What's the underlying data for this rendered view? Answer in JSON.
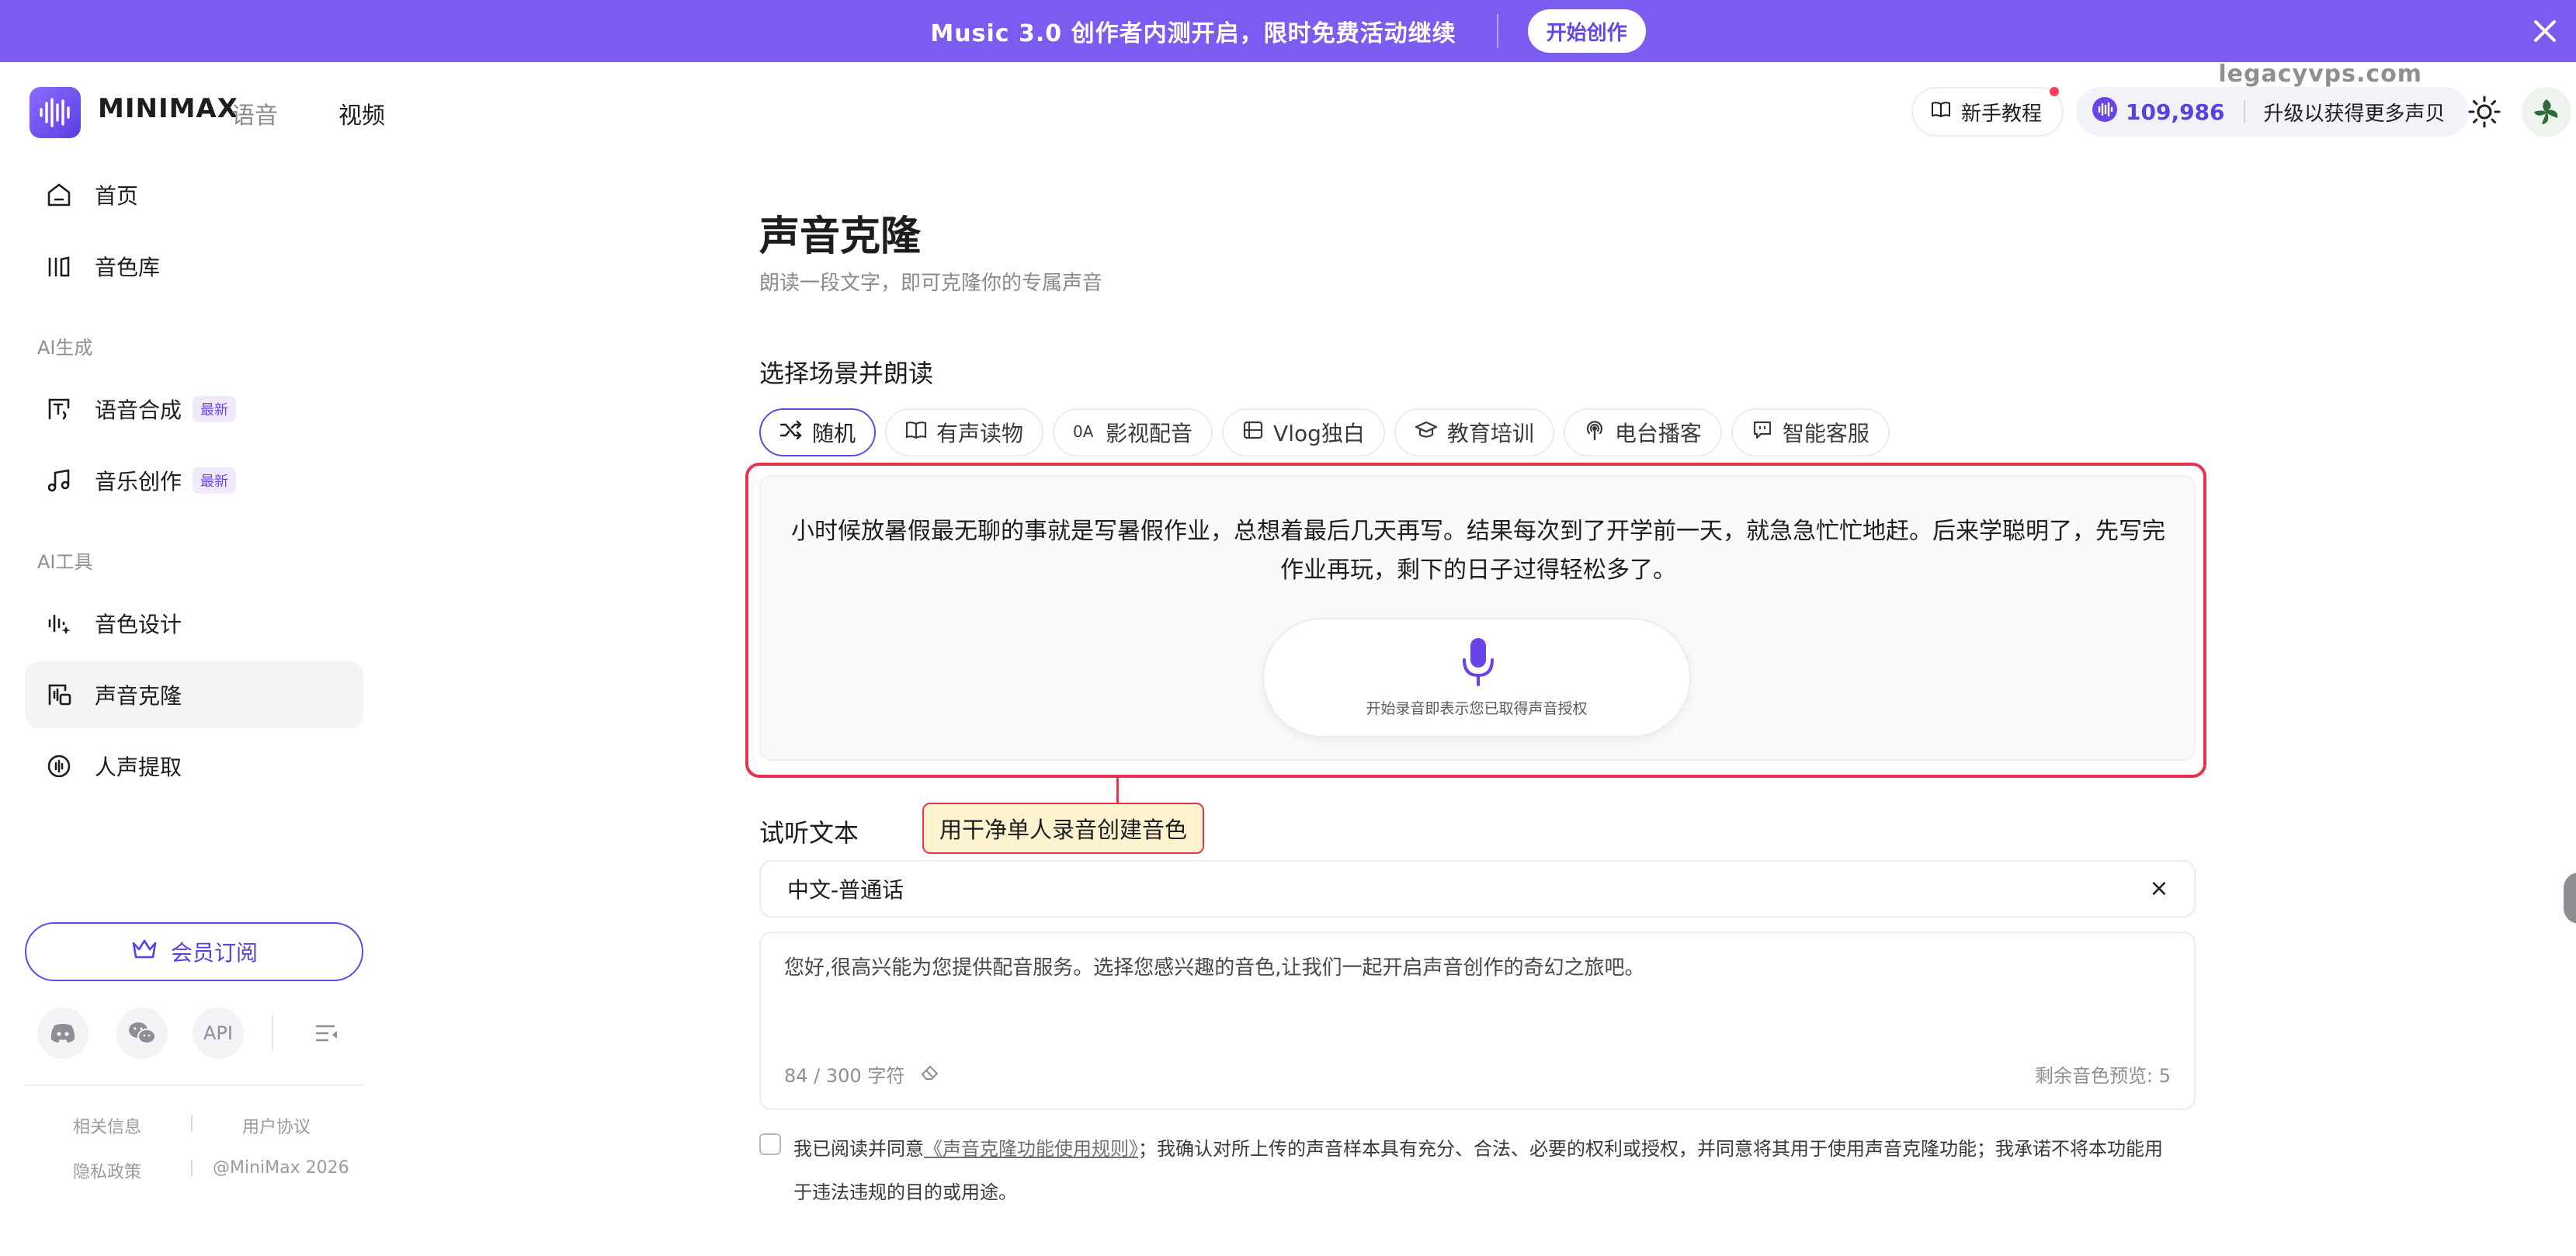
{
  "banner": {
    "text": "Music 3.0 创作者内测开启，限时免费活动继续",
    "button": "开始创作"
  },
  "header": {
    "brand": "MINIMAX",
    "brand_sub": "语音",
    "nav_video": "视频",
    "watermark": "legacyvps.com",
    "tutorial": "新手教程",
    "credits": "109,986",
    "upgrade": "升级以获得更多声贝"
  },
  "sidebar": {
    "home": "首页",
    "library": "音色库",
    "section_ai_gen": "AI生成",
    "tts": "语音合成",
    "music": "音乐创作",
    "badge_new": "最新",
    "section_ai_tools": "AI工具",
    "voice_design": "音色设计",
    "voice_clone": "声音克隆",
    "vocal_extract": "人声提取",
    "vip": "会员订阅",
    "api": "API",
    "footer": {
      "related": "相关信息",
      "terms": "用户协议",
      "privacy": "隐私政策",
      "copyright": "@MiniMax 2026"
    }
  },
  "main": {
    "title": "声音克隆",
    "subtitle": "朗读一段文字，即可克隆你的专属声音",
    "scene_heading": "选择场景并朗读",
    "tabs": [
      "随机",
      "有声读物",
      "影视配音",
      "Vlog独白",
      "教育培训",
      "电台播客",
      "智能客服"
    ],
    "read_text": "小时候放暑假最无聊的事就是写暑假作业，总想着最后几天再写。结果每次到了开学前一天，就急急忙忙地赶。后来学聪明了，先写完作业再玩，剩下的日子过得轻松多了。",
    "record_hint": "开始录音即表示您已取得声音授权",
    "tooltip": "用干净单人录音创建音色",
    "preview_heading": "试听文本",
    "language": "中文-普通话",
    "preview_text": "您好,很高兴能为您提供配音服务。选择您感兴趣的音色,让我们一起开启声音创作的奇幻之旅吧。",
    "char_count": "84 / 300 字符",
    "remaining": "剩余音色预览: 5",
    "agree_prefix": "我已阅读并同意",
    "agree_link": "《声音克隆功能使用规则》",
    "agree_suffix": "；我确认对所上传的声音样本具有充分、合法、必要的权利或授权，并同意将其用于使用声音克隆功能；我承诺不将本功能用于违法违规的目的或用途。"
  },
  "colors": {
    "accent": "#6a45e6",
    "banner": "#7c5cf0",
    "highlight": "#e8334f",
    "tooltip_bg": "#fdf4cf"
  }
}
